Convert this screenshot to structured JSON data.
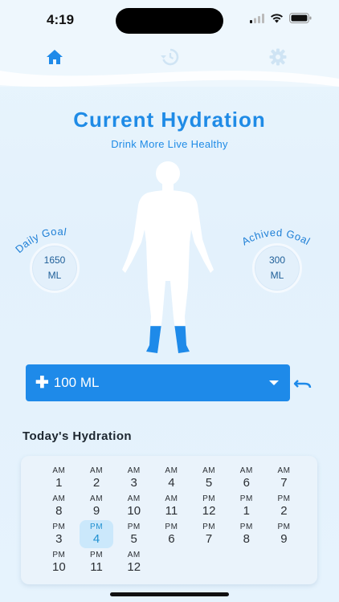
{
  "status": {
    "time": "4:19"
  },
  "nav": {
    "items": [
      "home-icon",
      "history-icon",
      "gear-icon"
    ],
    "active": "home-icon"
  },
  "hero": {
    "title": "Current Hydration",
    "subtitle": "Drink More Live Healthy"
  },
  "goals": {
    "daily": {
      "label": "Daily Goal",
      "value": "1650",
      "unit": "ML"
    },
    "achieved": {
      "label": "Achived Goal",
      "value": "300",
      "unit": "ML"
    },
    "fill_fraction": 0.18
  },
  "add": {
    "label": "100 ML",
    "icon": "plus-icon"
  },
  "today": {
    "title": "Today's Hydration",
    "hours": [
      {
        "ampm": "AM",
        "num": "1"
      },
      {
        "ampm": "AM",
        "num": "2"
      },
      {
        "ampm": "AM",
        "num": "3"
      },
      {
        "ampm": "AM",
        "num": "4"
      },
      {
        "ampm": "AM",
        "num": "5"
      },
      {
        "ampm": "AM",
        "num": "6"
      },
      {
        "ampm": "AM",
        "num": "7"
      },
      {
        "ampm": "AM",
        "num": "8"
      },
      {
        "ampm": "AM",
        "num": "9"
      },
      {
        "ampm": "AM",
        "num": "10"
      },
      {
        "ampm": "AM",
        "num": "11"
      },
      {
        "ampm": "PM",
        "num": "12"
      },
      {
        "ampm": "PM",
        "num": "1"
      },
      {
        "ampm": "PM",
        "num": "2"
      },
      {
        "ampm": "PM",
        "num": "3"
      },
      {
        "ampm": "PM",
        "num": "4",
        "selected": true
      },
      {
        "ampm": "PM",
        "num": "5"
      },
      {
        "ampm": "PM",
        "num": "6"
      },
      {
        "ampm": "PM",
        "num": "7"
      },
      {
        "ampm": "PM",
        "num": "8"
      },
      {
        "ampm": "PM",
        "num": "9"
      },
      {
        "ampm": "PM",
        "num": "10"
      },
      {
        "ampm": "PM",
        "num": "11"
      },
      {
        "ampm": "AM",
        "num": "12"
      }
    ]
  },
  "colors": {
    "accent": "#1e8ae9",
    "water": "#1e8ae9",
    "selected_bg": "#cbe8fb"
  }
}
